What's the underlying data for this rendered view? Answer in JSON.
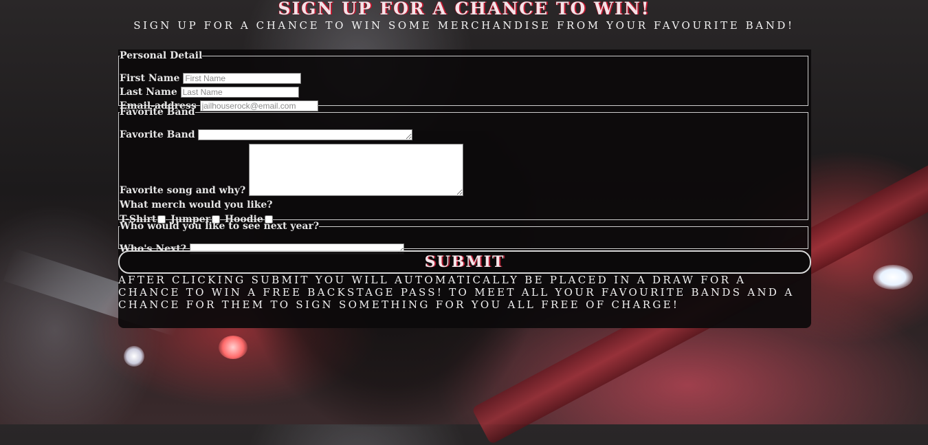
{
  "header": {
    "title": "SIGN UP FOR A CHANCE TO WIN!",
    "subtitle": "SIGN UP FOR A CHANCE TO WIN SOME MERCHANDISE FROM YOUR FAVOURITE BAND!"
  },
  "personal": {
    "legend": "Personal Detail",
    "first_name_label": "First Name",
    "first_name_placeholder": "First Name",
    "last_name_label": "Last Name",
    "last_name_placeholder": "Last Name",
    "email_label": "Email-address",
    "email_placeholder": "jailhouserock@email.com"
  },
  "band": {
    "legend": "Favorite Band",
    "favorite_band_label": "Favorite Band",
    "favorite_song_label": "Favorite song and why?",
    "merch_question": "What merch would you like?",
    "merch_options": [
      "T-Shirt",
      "Jumper",
      "Hoodie"
    ]
  },
  "next": {
    "legend": "Who would you like to see next year?",
    "whos_next_label": "Who's Next?"
  },
  "submit_label": "SUBMIT",
  "note": "AFTER CLICKING SUBMIT YOU WILL AUTOMATICALLY BE PLACED IN A DRAW FOR A CHANCE TO WIN A FREE BACKSTAGE PASS! TO MEET ALL YOUR FAVOURITE BANDS AND A CHANCE FOR THEM TO SIGN SOMETHING FOR YOU ALL FREE OF CHARGE!",
  "colors": {
    "accent_red": "#c2182f",
    "panel": "#0c0a0b"
  }
}
